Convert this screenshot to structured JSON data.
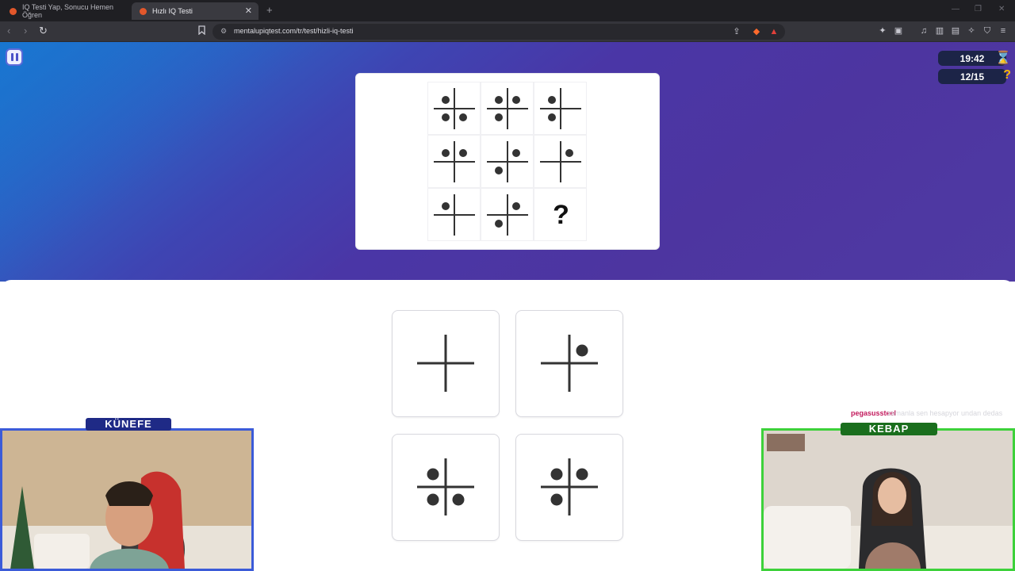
{
  "browser": {
    "tabs": [
      {
        "title": "IQ Testi Yap, Sonucu Hemen Öğren",
        "active": false
      },
      {
        "title": "Hızlı IQ Testi",
        "active": true
      }
    ],
    "url": "mentalupiqtest.com/tr/test/hizli-iq-testi"
  },
  "quiz": {
    "timer": "19:42",
    "progress": "12/15",
    "question_mark": "?",
    "matrix": [
      [
        "TL,BL,BR",
        "TL,TR,BL",
        "TL,BL"
      ],
      [
        "TL,TR",
        "TR,BL",
        "TR"
      ],
      [
        "TL",
        "TR,BL",
        "?"
      ]
    ],
    "options": [
      "none",
      "TR",
      "TL,BL,BR",
      "TL,TR,BL"
    ]
  },
  "stream": {
    "left_label": "KÜNEFE",
    "right_label": "KEBAP",
    "chat_user": "pegasussteel",
    "chat_message": "zamanla sen hesapyor undan dedas"
  },
  "colors": {
    "accent": "#4d35a0",
    "left_frame": "#3b5bd8",
    "right_frame": "#3dd13a"
  }
}
